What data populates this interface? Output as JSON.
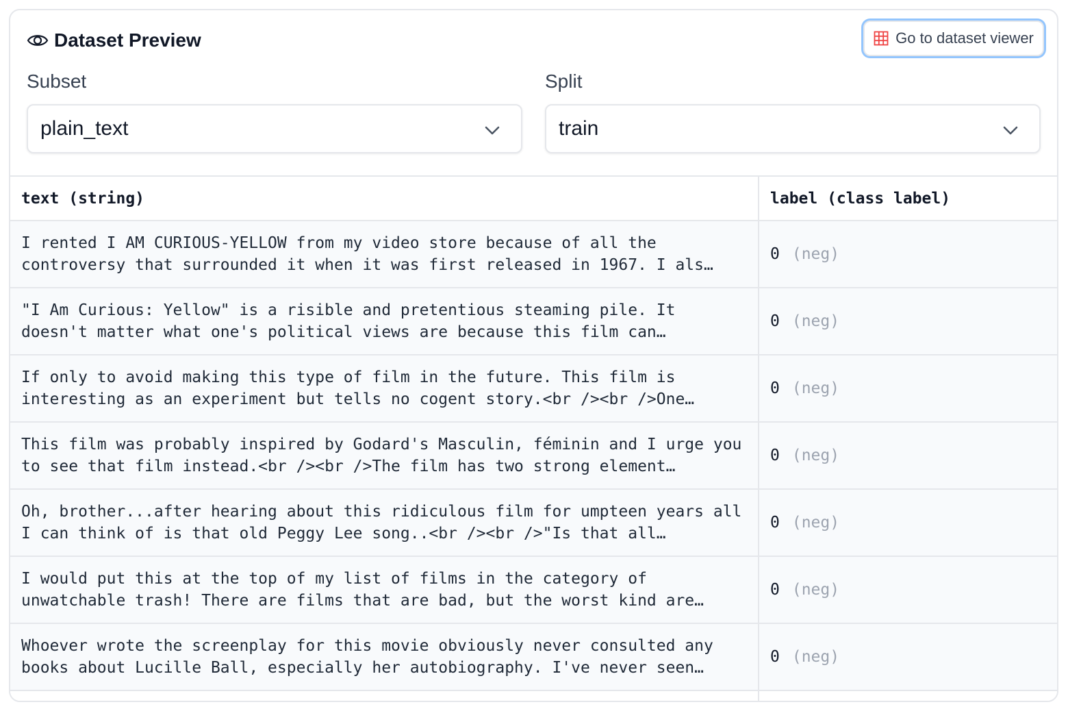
{
  "header": {
    "title": "Dataset Preview",
    "icon": "eye-icon"
  },
  "viewer_button": {
    "label": "Go to dataset viewer",
    "icon": "grid-icon",
    "icon_color": "#ef4444"
  },
  "subset": {
    "label": "Subset",
    "value": "plain_text"
  },
  "split": {
    "label": "Split",
    "value": "train"
  },
  "table": {
    "columns": [
      "text (string)",
      "label (class label)"
    ],
    "rows": [
      {
        "text": "I rented I AM CURIOUS-YELLOW from my video store because of all the controversy that surrounded it when it was first released in 1967. I als…",
        "label_value": "0",
        "label_name": "(neg)"
      },
      {
        "text": "\"I Am Curious: Yellow\" is a risible and pretentious steaming pile. It doesn't matter what one's political views are because this film can…",
        "label_value": "0",
        "label_name": "(neg)"
      },
      {
        "text": "If only to avoid making this type of film in the future. This film is interesting as an experiment but tells no cogent story.<br /><br />One…",
        "label_value": "0",
        "label_name": "(neg)"
      },
      {
        "text": "This film was probably inspired by Godard's Masculin, féminin and I urge you to see that film instead.<br /><br />The film has two strong element…",
        "label_value": "0",
        "label_name": "(neg)"
      },
      {
        "text": "Oh, brother...after hearing about this ridiculous film for umpteen years all I can think of is that old Peggy Lee song..<br /><br />\"Is that all…",
        "label_value": "0",
        "label_name": "(neg)"
      },
      {
        "text": "I would put this at the top of my list of films in the category of unwatchable trash! There are films that are bad, but the worst kind are…",
        "label_value": "0",
        "label_name": "(neg)"
      },
      {
        "text": "Whoever wrote the screenplay for this movie obviously never consulted any books about Lucille Ball, especially her autobiography. I've never seen…",
        "label_value": "0",
        "label_name": "(neg)"
      }
    ]
  },
  "colors": {
    "border": "#e5e7eb",
    "row_bg": "#f8fafc",
    "focus_ring": "#93c5fd",
    "muted": "#9ca3af"
  }
}
